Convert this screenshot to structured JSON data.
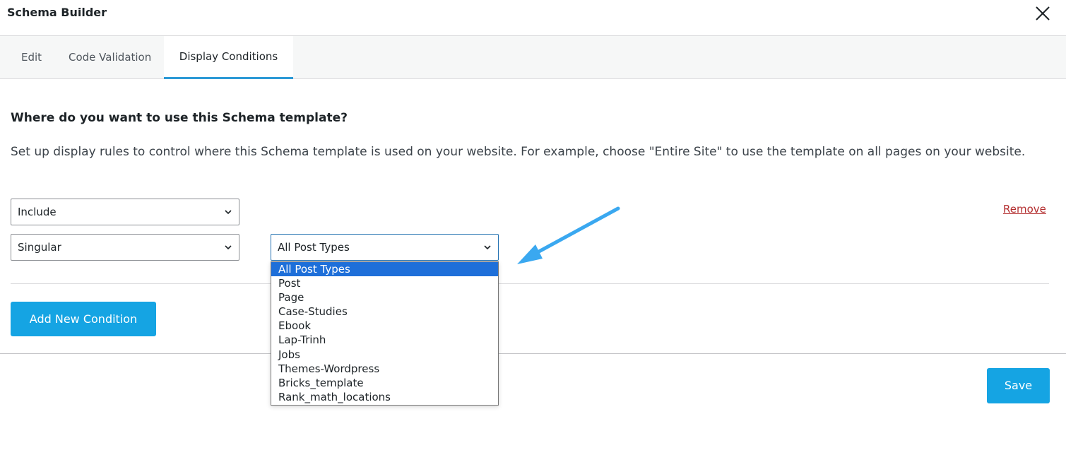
{
  "modal": {
    "title": "Schema Builder"
  },
  "tabs": [
    {
      "label": "Edit"
    },
    {
      "label": "Code Validation"
    },
    {
      "label": "Display Conditions"
    }
  ],
  "active_tab": "Display Conditions",
  "display_conditions": {
    "question": "Where do you want to use this Schema template?",
    "description": "Set up display rules to control where this Schema template is used on your website. For example, choose \"Entire Site\" to use the template on all pages on your website.",
    "rule_type_select": {
      "value": "Include"
    },
    "location_select": {
      "value": "Singular"
    },
    "post_type_select": {
      "value": "All Post Types",
      "options": [
        "All Post Types",
        "Post",
        "Page",
        "Case-Studies",
        "Ebook",
        "Lap-Trinh",
        "Jobs",
        "Themes-Wordpress",
        "Bricks_template",
        "Rank_math_locations"
      ]
    },
    "remove_label": "Remove",
    "add_condition_label": "Add New Condition"
  },
  "footer": {
    "save_label": "Save"
  },
  "colors": {
    "accent": "#15a4e3",
    "tab_underline": "#2c99d6",
    "remove": "#b32d2e",
    "selected_option": "#1e6fd9",
    "annotation_arrow": "#3aa8f0"
  },
  "icons": {
    "close": "close-icon",
    "chevron": "chevron-down-icon",
    "annotation": "arrow-annotation-icon"
  }
}
